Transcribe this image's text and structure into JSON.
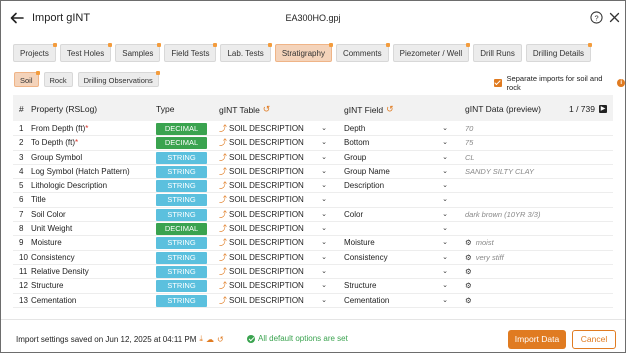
{
  "header": {
    "title": "Import gINT",
    "file": "EA300HO.gpj"
  },
  "tabs": [
    {
      "label": "Projects",
      "dot": true
    },
    {
      "label": "Test Holes",
      "dot": true
    },
    {
      "label": "Samples",
      "dot": true
    },
    {
      "label": "Field Tests",
      "dot": true
    },
    {
      "label": "Lab. Tests",
      "dot": true
    },
    {
      "label": "Stratigraphy",
      "dot": true,
      "active": true
    },
    {
      "label": "Comments",
      "dot": true
    },
    {
      "label": "Piezometer / Well",
      "dot": true
    },
    {
      "label": "Drill Runs",
      "dot": false
    },
    {
      "label": "Drilling Details",
      "dot": true
    }
  ],
  "subtabs": [
    {
      "label": "Soil",
      "dot": true,
      "active": true
    },
    {
      "label": "Rock",
      "dot": false
    },
    {
      "label": "Drilling Observations",
      "dot": true
    }
  ],
  "separate_imports": {
    "label": "Separate imports for soil and rock",
    "checked": true
  },
  "table": {
    "headers": {
      "num": "#",
      "property": "Property (RSLog)",
      "type": "Type",
      "gint_table": "gINT Table",
      "gint_field": "gINT Field",
      "gint_data": "gINT Data (preview)"
    },
    "pager": "1 / 739",
    "rows": [
      {
        "num": "1",
        "prop": "From Depth (ft)",
        "req": "*",
        "type": "DECIMAL",
        "table": "SOIL DESCRIPTION",
        "field": "Depth",
        "preview": "70",
        "gear": false
      },
      {
        "num": "2",
        "prop": "To Depth (ft)",
        "req": "*",
        "type": "DECIMAL",
        "table": "SOIL DESCRIPTION",
        "field": "Bottom",
        "preview": "75",
        "gear": false
      },
      {
        "num": "3",
        "prop": "Group Symbol",
        "req": "",
        "type": "STRING",
        "table": "SOIL DESCRIPTION",
        "field": "Group",
        "preview": "CL",
        "gear": false
      },
      {
        "num": "4",
        "prop": "Log Symbol (Hatch Pattern)",
        "req": "",
        "type": "STRING",
        "table": "SOIL DESCRIPTION",
        "field": "Group Name",
        "preview": "SANDY SILTY CLAY",
        "gear": false
      },
      {
        "num": "5",
        "prop": "Lithologic Description",
        "req": "",
        "type": "STRING",
        "table": "SOIL DESCRIPTION",
        "field": "Description",
        "preview": "",
        "gear": false
      },
      {
        "num": "6",
        "prop": "Title",
        "req": "",
        "type": "STRING",
        "table": "SOIL DESCRIPTION",
        "field": "",
        "preview": "",
        "gear": false
      },
      {
        "num": "7",
        "prop": "Soil Color",
        "req": "",
        "type": "STRING",
        "table": "SOIL DESCRIPTION",
        "field": "Color",
        "preview": "dark brown (10YR 3/3)",
        "gear": false
      },
      {
        "num": "8",
        "prop": "Unit Weight",
        "req": "",
        "type": "DECIMAL",
        "table": "SOIL DESCRIPTION",
        "field": "",
        "preview": "",
        "gear": false
      },
      {
        "num": "9",
        "prop": "Moisture",
        "req": "",
        "type": "STRING",
        "table": "SOIL DESCRIPTION",
        "field": "Moisture",
        "preview": "moist",
        "gear": true
      },
      {
        "num": "10",
        "prop": "Consistency",
        "req": "",
        "type": "STRING",
        "table": "SOIL DESCRIPTION",
        "field": "Consistency",
        "preview": "very stiff",
        "gear": true
      },
      {
        "num": "11",
        "prop": "Relative Density",
        "req": "",
        "type": "STRING",
        "table": "SOIL DESCRIPTION",
        "field": "",
        "preview": "",
        "gear": true
      },
      {
        "num": "12",
        "prop": "Structure",
        "req": "",
        "type": "STRING",
        "table": "SOIL DESCRIPTION",
        "field": "Structure",
        "preview": "",
        "gear": true
      },
      {
        "num": "13",
        "prop": "Cementation",
        "req": "",
        "type": "STRING",
        "table": "SOIL DESCRIPTION",
        "field": "Cementation",
        "preview": "",
        "gear": true
      }
    ]
  },
  "footer": {
    "saved": "Import settings saved on Jun 12, 2025 at 04:11 PM",
    "status": "All default options are set",
    "import_label": "Import Data",
    "cancel_label": "Cancel"
  },
  "colors": {
    "accent": "#e07b21",
    "decimal": "#3aa34f",
    "string": "#5bc0de",
    "active_tab": "#f4d3ba"
  }
}
